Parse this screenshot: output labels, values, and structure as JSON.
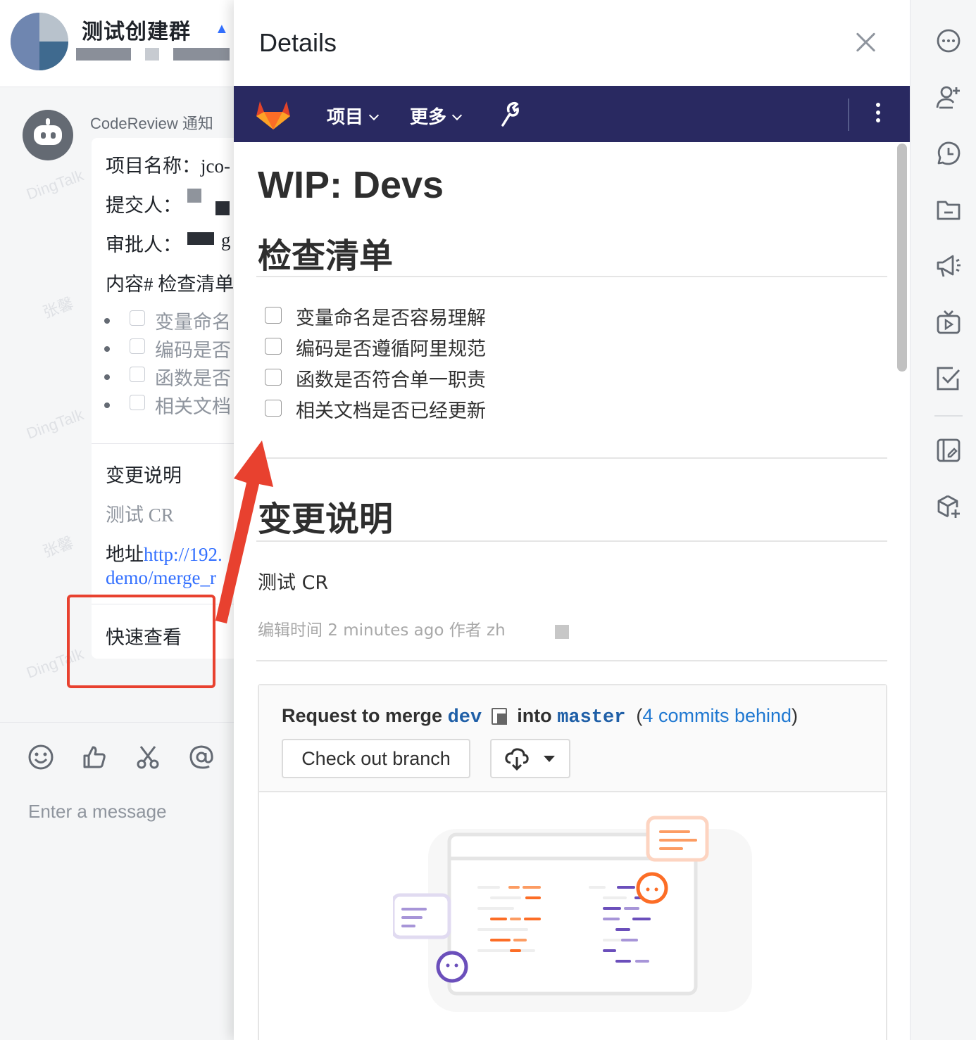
{
  "chat": {
    "group_title": "测试创建群",
    "bot_name": "CodeReview 通知",
    "card": {
      "project_label": "项目名称：jco-",
      "submitter_label": "提交人：",
      "approver_label": "审批人：",
      "approver_suffix": "g",
      "content_label": "内容# 检查清单",
      "checklist": [
        "变量命名",
        "编码是否",
        "函数是否",
        "相关文档"
      ],
      "change_title": "变更说明",
      "change_text": "测试 CR",
      "address_label": "地址",
      "address_link": "http://192.",
      "address_link_2": "demo/merge_r",
      "quick_view": "快速查看"
    },
    "watermarks": [
      "DingTalk",
      "张馨",
      "DingTalk",
      "张馨",
      "DingTalk"
    ],
    "composer": {
      "tools": [
        "emoji-icon",
        "thumbs-up-icon",
        "scissors-icon",
        "at-icon"
      ],
      "placeholder": "Enter a message"
    }
  },
  "details": {
    "title": "Details",
    "gitlab_nav": {
      "items": [
        "项目",
        "更多"
      ]
    },
    "mr_title": "WIP: Devs",
    "checklist_heading": "检查清单",
    "checklist": [
      "变量命名是否容易理解",
      "编码是否遵循阿里规范",
      "函数是否符合单一职责",
      "相关文档是否已经更新"
    ],
    "change_heading": "变更说明",
    "change_text": "测试 CR",
    "edited": "编辑时间 2 minutes ago 作者 zh",
    "merge_widget": {
      "request_text": "Request to merge",
      "source_branch": "dev",
      "into_text": "into",
      "target_branch": "master",
      "open_paren": "(",
      "behind_link": "4 commits behind",
      "close_paren": ")",
      "checkout_button": "Check out branch"
    }
  },
  "right_toolbar": {
    "icons": [
      "more-icon",
      "add-member-icon",
      "history-icon",
      "folder-icon",
      "announcement-icon",
      "live-icon",
      "todo-icon",
      "note-icon",
      "add-app-icon"
    ]
  },
  "colors": {
    "gitlab_nav": "#292961",
    "annotation_red": "#e8412f",
    "link_blue": "#1f78d1"
  }
}
